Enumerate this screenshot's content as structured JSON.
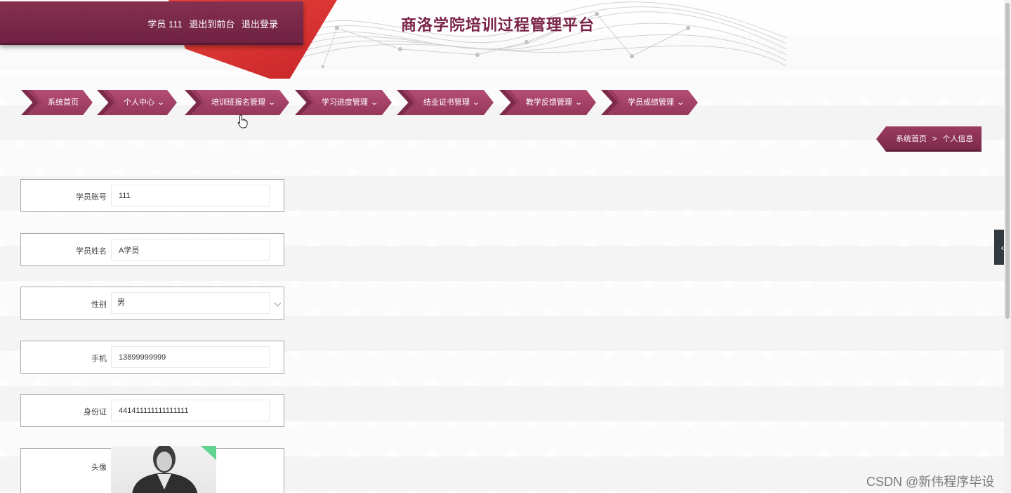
{
  "header": {
    "site_title": "商洛学院培训过程管理平台",
    "user_label": "学员 111",
    "back_to_front": "退出到前台",
    "logout": "退出登录"
  },
  "nav": {
    "items": [
      {
        "label": "系统首页",
        "dropdown": false
      },
      {
        "label": "个人中心",
        "dropdown": true
      },
      {
        "label": "培训班报名管理",
        "dropdown": true
      },
      {
        "label": "学习进度管理",
        "dropdown": true
      },
      {
        "label": "结业证书管理",
        "dropdown": true
      },
      {
        "label": "教学反馈管理",
        "dropdown": true
      },
      {
        "label": "学员成绩管理",
        "dropdown": true
      }
    ],
    "caret": "⌄"
  },
  "breadcrumb": {
    "home": "系统首页",
    "separator": ">",
    "current": "个人信息"
  },
  "form": {
    "account_label": "学员账号",
    "account_value": "111",
    "name_label": "学员姓名",
    "name_value": "A学员",
    "gender_label": "性别",
    "gender_value": "男",
    "phone_label": "手机",
    "phone_value": "13899999999",
    "id_label": "身份证",
    "id_value": "441411111111111111",
    "avatar_label": "头像"
  },
  "side_tab": {
    "icon": "‹"
  },
  "watermark": "CSDN @新伟程序毕设",
  "colors": {
    "brand": "#7a2347",
    "nav_bg": "#a8436a",
    "accent_red": "#e8433a"
  }
}
